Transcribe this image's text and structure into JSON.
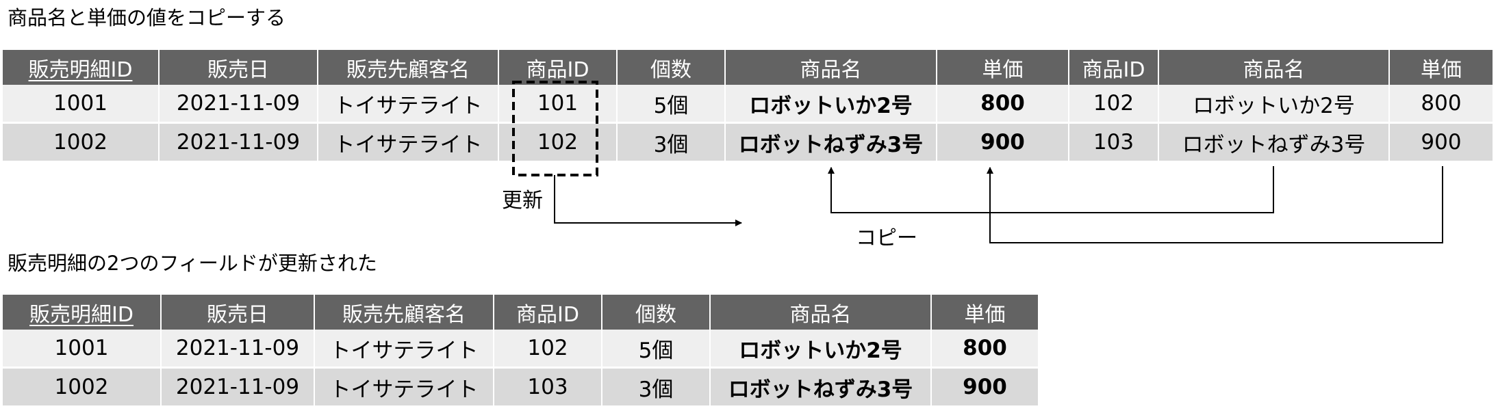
{
  "title_top": "商品名と単価の値をコピーする",
  "title_bottom": "販売明細の2つのフィールドが更新された",
  "top_table": {
    "headers": [
      "販売明細ID",
      "販売日",
      "販売先顧客名",
      "商品ID",
      "個数",
      "商品名",
      "単価",
      "商品ID",
      "商品名",
      "単価"
    ],
    "rows": [
      [
        "1001",
        "2021-11-09",
        "トイサテライト",
        "101",
        "5個",
        "ロボットいか2号",
        "800",
        "102",
        "ロボットいか2号",
        "800"
      ],
      [
        "1002",
        "2021-11-09",
        "トイサテライト",
        "102",
        "3個",
        "ロボットねずみ3号",
        "900",
        "103",
        "ロボットねずみ3号",
        "900"
      ]
    ]
  },
  "bottom_table": {
    "headers": [
      "販売明細ID",
      "販売日",
      "販売先顧客名",
      "商品ID",
      "個数",
      "商品名",
      "単価"
    ],
    "rows": [
      [
        "1001",
        "2021-11-09",
        "トイサテライト",
        "102",
        "5個",
        "ロボットいか2号",
        "800"
      ],
      [
        "1002",
        "2021-11-09",
        "トイサテライト",
        "103",
        "3個",
        "ロボットねずみ3号",
        "900"
      ]
    ]
  },
  "annotations": {
    "update_label": "更新",
    "copy_label": "コピー"
  }
}
